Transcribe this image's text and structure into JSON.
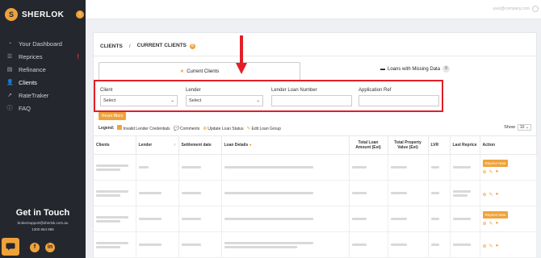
{
  "app": {
    "logo_text": "SHERLOK",
    "logo_glyph": "S",
    "collapse_glyph": "‹"
  },
  "sidebar": {
    "items": [
      {
        "label": "Your Dashboard",
        "icon": "gauge-icon",
        "glyph": "◔"
      },
      {
        "label": "Reprices",
        "icon": "list-icon",
        "glyph": "☰",
        "badge": "!"
      },
      {
        "label": "Refinance",
        "icon": "layers-icon",
        "glyph": "▤"
      },
      {
        "label": "Clients",
        "icon": "users-icon",
        "glyph": "👤"
      },
      {
        "label": "RateTraker",
        "icon": "chart-icon",
        "glyph": "↗"
      },
      {
        "label": "FAQ",
        "icon": "help-icon",
        "glyph": "ⓘ"
      }
    ],
    "touch_title": "Get in Touch",
    "touch_email": "brokersupport@sherlok.com.au",
    "touch_phone": "1300 664 886",
    "facebook": "f",
    "linkedin": "in"
  },
  "topbar": {
    "user_email": "user@company.com"
  },
  "breadcrumb": {
    "clients": "CLIENTS",
    "separator": "/",
    "current": "CURRENT CLIENTS",
    "count": "0"
  },
  "tabs": {
    "current": "Current Clients",
    "missing": "Loans with Missing Data",
    "missing_count": "0"
  },
  "filters": {
    "client": {
      "label": "Client",
      "value": "Select"
    },
    "lender": {
      "label": "Lender",
      "value": "Select"
    },
    "lender_loan_number": {
      "label": "Lender Loan Number",
      "value": ""
    },
    "application_ref": {
      "label": "Application Ref",
      "value": ""
    }
  },
  "reset_label": "Reset filters",
  "legend": {
    "title": "Legend:",
    "items": [
      "Invalid Lender Credentials",
      "Comments",
      "Update Loan Status",
      "Edit Loan Group"
    ]
  },
  "show": {
    "label": "Show",
    "value": "10"
  },
  "table": {
    "headers": {
      "clients": "Clients",
      "lender": "Lender",
      "settlement": "Settlement date",
      "loan_details": "Loan Details",
      "total_loan": "Total Loan Amount (Est)",
      "total_property": "Total Property Value (Est)",
      "lvr": "LVR",
      "last_reprice": "Last Reprice",
      "action": "Action"
    },
    "reprice_label": "Reprice Now"
  },
  "colors": {
    "accent": "#f0a23a",
    "sidebar": "#25272e",
    "highlight": "#e21f26"
  }
}
